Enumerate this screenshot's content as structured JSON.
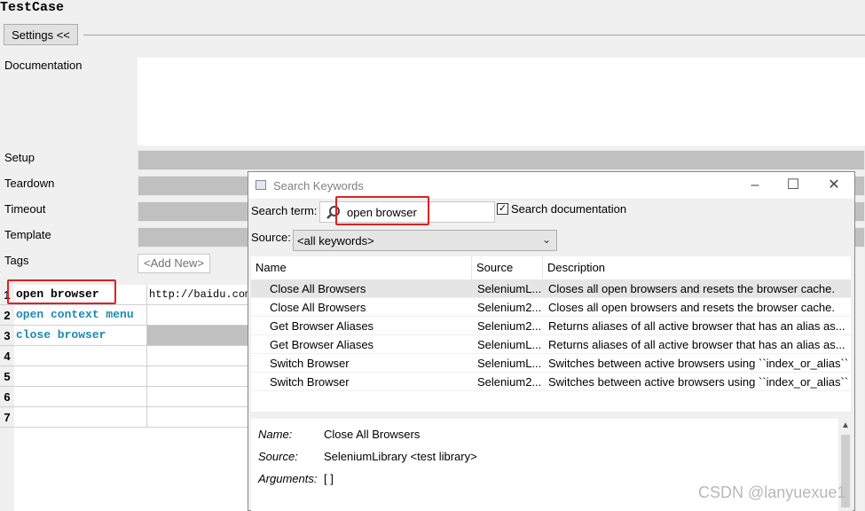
{
  "page": {
    "title": "TestCase"
  },
  "settings": {
    "button_label": "Settings <<"
  },
  "labels": {
    "documentation": "Documentation",
    "setup": "Setup",
    "teardown": "Teardown",
    "timeout": "Timeout",
    "template": "Template",
    "tags": "Tags"
  },
  "tags": {
    "add_new": "<Add New>"
  },
  "grid": {
    "rows": [
      {
        "num": "1",
        "keyword": "open browser",
        "arg": "http://baidu.com"
      },
      {
        "num": "2",
        "keyword": "open context menu",
        "arg": ""
      },
      {
        "num": "3",
        "keyword": "close browser",
        "arg": ""
      },
      {
        "num": "4",
        "keyword": "",
        "arg": ""
      },
      {
        "num": "5",
        "keyword": "",
        "arg": ""
      },
      {
        "num": "6",
        "keyword": "",
        "arg": ""
      },
      {
        "num": "7",
        "keyword": "",
        "arg": ""
      }
    ]
  },
  "dialog": {
    "title": "Search Keywords",
    "search_term_label": "Search term:",
    "search_value": "open browser",
    "search_doc_label": "Search documentation",
    "search_doc_checked": true,
    "source_label": "Source:",
    "source_value": "<all keywords>",
    "columns": [
      "Name",
      "Source",
      "Description"
    ],
    "results": [
      {
        "name": "Close All Browsers",
        "source": "SeleniumL...",
        "desc": "Closes all open browsers and resets the browser cache."
      },
      {
        "name": "Close All Browsers",
        "source": "Selenium2...",
        "desc": "Closes all open browsers and resets the browser cache."
      },
      {
        "name": "Get Browser Aliases",
        "source": "Selenium2...",
        "desc": "Returns aliases of all active browser that has an alias as..."
      },
      {
        "name": "Get Browser Aliases",
        "source": "SeleniumL...",
        "desc": "Returns aliases of all active browser that has an alias as..."
      },
      {
        "name": "Switch Browser",
        "source": "SeleniumL...",
        "desc": "Switches between active browsers using ``index_or_alias``."
      },
      {
        "name": "Switch Browser",
        "source": "Selenium2...",
        "desc": "Switches between active browsers using ``index_or_alias``."
      }
    ],
    "detail": {
      "name_label": "Name:",
      "name_value": "Close All Browsers",
      "source_label": "Source:",
      "source_value": "SeleniumLibrary <test library>",
      "args_label": "Arguments:",
      "args_value": "[ ]"
    }
  },
  "watermark": "CSDN @lanyuexue1",
  "colors": {
    "keyword": "#1d8ab0",
    "highlight": "#e02020",
    "selected_row": "#e5e5e5"
  }
}
